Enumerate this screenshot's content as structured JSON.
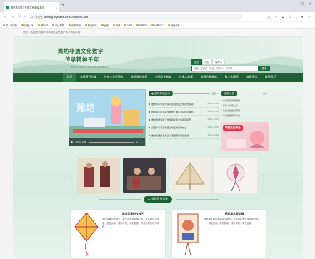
{
  "browser": {
    "tab_title": "潍坊市非遗文化数字资源库-首页",
    "url_security": "不安全",
    "url": "weifang.feiyibaike.cn:9003/index/Chart",
    "bookmarks": [
      "导入的书签",
      "百度一下",
      "hao123",
      "网上购物",
      "京东商城",
      "精选网站",
      "优选",
      "影视",
      "Ctrip",
      "MyBlog",
      "ChatGPT",
      "其他书签"
    ]
  },
  "site": {
    "top_text": "您好，欢迎来到潍坊市非物质文化遗产数字资源平台",
    "logo_line1": "潍坊非遗文化数字",
    "logo_line2": "传承精神千年",
    "logo_sub": "潍坊市非物质文化遗产数字资源平台",
    "search_tabs": [
      "全站",
      "项目",
      "传承人"
    ],
    "search_placeholder": "请输入关键词：项目、传承人、资讯等",
    "search_button": "搜索"
  },
  "nav": [
    "首页",
    "非遗项目名录",
    "传统文化资源库",
    "非遗保护成果",
    "非遗文化普查",
    "传承人档案",
    "非遗传承基地",
    "数字化展示",
    "非遗资讯",
    "联系我们"
  ],
  "news": {
    "title": "潍坊非遗资讯",
    "more": "更多>>",
    "items": [
      {
        "t": "潍坊风筝非遗传承人走进校园开展教学活动",
        "d": "2024-10-25"
      },
      {
        "t": "杨家埠木版年画传统技艺展示活动成功举办",
        "d": "2024-10-18"
      },
      {
        "t": "潍坊非遗保护工作经验交流会议顺利召开",
        "d": "2024-10-12"
      },
      {
        "t": "高密扑灰年画非遗工坊正式揭牌成立",
        "d": "2024-10-05"
      },
      {
        "t": "潍坊核雕技艺作品入选国家级非遗展览",
        "d": "2024-09-28"
      }
    ]
  },
  "notice": {
    "title": "通知公告",
    "more": "更多",
    "items": [
      "非遗项目申报通知",
      "传承人认定公示",
      "非遗工作会议通知",
      "年度非遗保护计划"
    ]
  },
  "promo": {
    "label": "非遗文化特色"
  },
  "video": {
    "time": "0:00 / 1:36"
  },
  "section2": {
    "title": "非遗项目名录"
  },
  "cards": [
    {
      "title": "潍坊风筝制作技艺",
      "desc": "潍坊风筝历史悠久，被誉为世界风筝之都，其扎制技艺精湛，造型优美，题材丰富，色彩艳丽，具有浓郁的地方特色。"
    },
    {
      "title": "杨家埠木版年画",
      "desc": "杨家埠木版年画起源于明代，是中国民间传统年画代表之一，构图饱满，色彩鲜艳，线条流畅，寓意吉祥。"
    }
  ]
}
